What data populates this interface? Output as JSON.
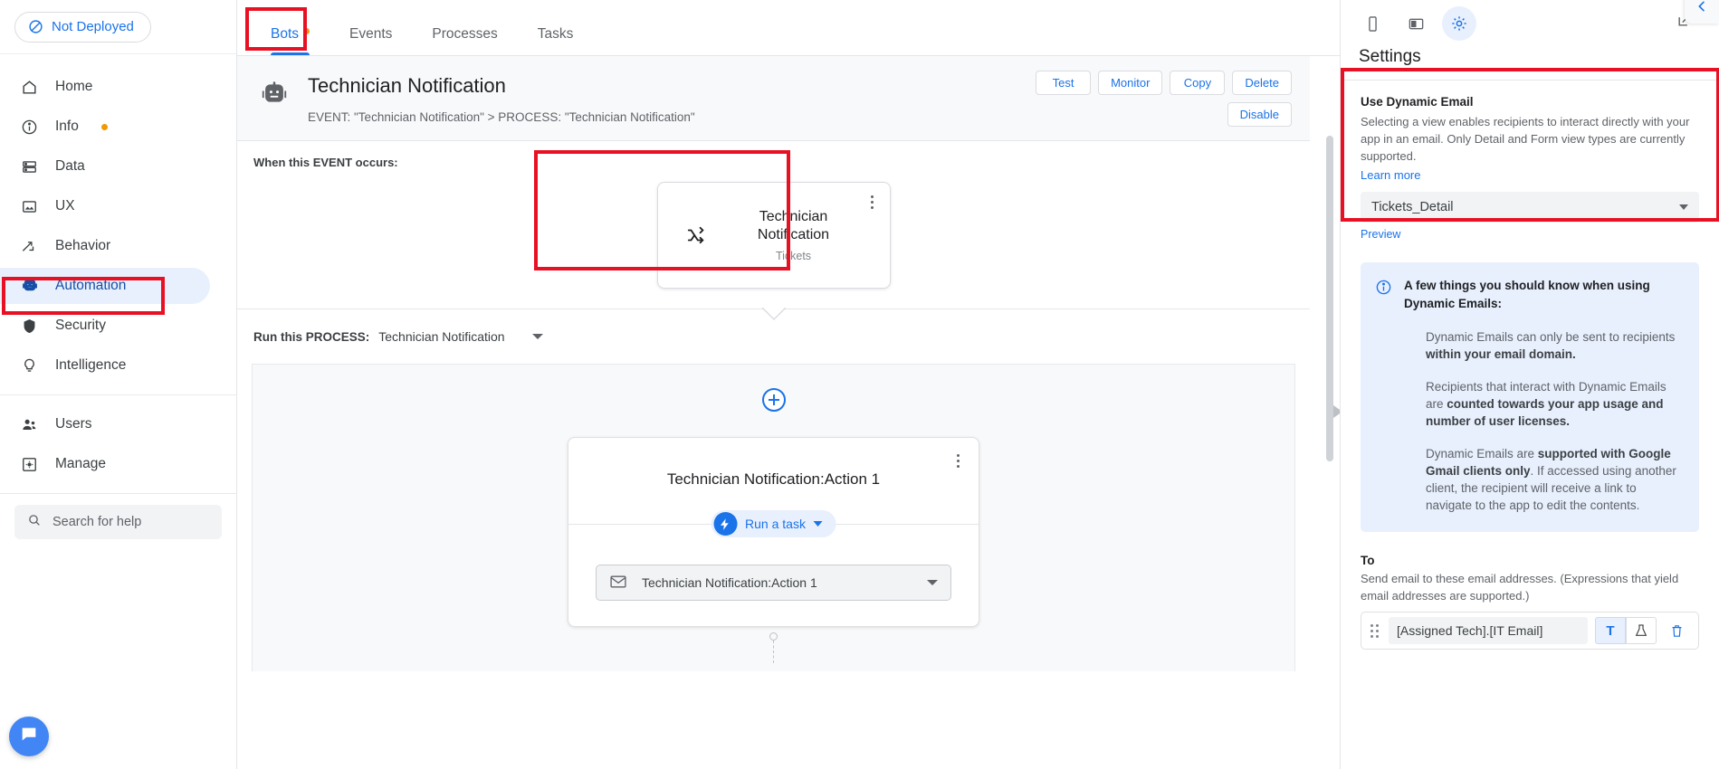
{
  "sidebar": {
    "deploy_status": "Not Deployed",
    "items": [
      {
        "label": "Home",
        "icon": "home-icon",
        "dot": false
      },
      {
        "label": "Info",
        "icon": "info-icon",
        "dot": true
      },
      {
        "label": "Data",
        "icon": "data-icon",
        "dot": false
      },
      {
        "label": "UX",
        "icon": "ux-icon",
        "dot": false
      },
      {
        "label": "Behavior",
        "icon": "behavior-icon",
        "dot": false
      },
      {
        "label": "Automation",
        "icon": "automation-robot-icon",
        "dot": false,
        "active": true
      },
      {
        "label": "Security",
        "icon": "shield-icon",
        "dot": false
      },
      {
        "label": "Intelligence",
        "icon": "lightbulb-icon",
        "dot": false
      }
    ],
    "items_secondary": [
      {
        "label": "Users",
        "icon": "users-icon"
      },
      {
        "label": "Manage",
        "icon": "manage-gear-icon"
      }
    ],
    "search_placeholder": "Search for help"
  },
  "tabs": [
    {
      "label": "Bots",
      "active": true,
      "dot": true
    },
    {
      "label": "Events",
      "active": false,
      "dot": false
    },
    {
      "label": "Processes",
      "active": false,
      "dot": false
    },
    {
      "label": "Tasks",
      "active": false,
      "dot": false
    }
  ],
  "bot": {
    "title": "Technician Notification",
    "subtitle": "EVENT: \"Technician Notification\" > PROCESS: \"Technician Notification\"",
    "actions_row1": [
      "Test",
      "Monitor",
      "Copy",
      "Delete"
    ],
    "actions_row2": [
      "Disable"
    ]
  },
  "event": {
    "section_label": "When this EVENT occurs:",
    "card_title": "Technician Notification",
    "card_subtitle": "Tickets"
  },
  "process": {
    "label": "Run this PROCESS:",
    "value": "Technician Notification"
  },
  "action": {
    "title": "Technician Notification:Action 1",
    "run_chip": "Run a task",
    "task_value": "Technician Notification:Action 1"
  },
  "settings": {
    "title": "Settings",
    "toolbar_icons": [
      "phone-icon",
      "tablet-icon",
      "gear-icon",
      "expand-icon",
      "collapse-icon"
    ],
    "dynamic_email": {
      "label": "Use Dynamic Email",
      "description": "Selecting a view enables recipients to interact directly with your app in an email. Only Detail and Form view types are currently supported.",
      "learn_more": "Learn more",
      "selected_view": "Tickets_Detail",
      "preview": "Preview"
    },
    "info": {
      "heading": "A few things you should know when using Dynamic Emails:",
      "paragraphs": [
        {
          "pre": "Dynamic Emails can only be sent to recipients ",
          "bold": "within your email domain.",
          "post": ""
        },
        {
          "pre": "Recipients that interact with Dynamic Emails are ",
          "bold": "counted towards your app usage and number of user licenses.",
          "post": ""
        },
        {
          "pre": "Dynamic Emails are ",
          "bold": "supported with Google Gmail clients only",
          "post": ". If accessed using another client, the recipient will receive a link to navigate to the app to edit the contents."
        }
      ]
    },
    "to": {
      "label": "To",
      "description": "Send email to these email addresses. (Expressions that yield email addresses are supported.)",
      "value": "[Assigned Tech].[IT Email]",
      "toggle_text": "T",
      "toggle_flask": "flask-icon"
    }
  },
  "colors": {
    "accent": "#1a73e8",
    "accent_dark": "#174ea6",
    "highlight_bg": "#e8f0fe",
    "annotation": "#e81123",
    "warn_dot": "#f29900"
  }
}
